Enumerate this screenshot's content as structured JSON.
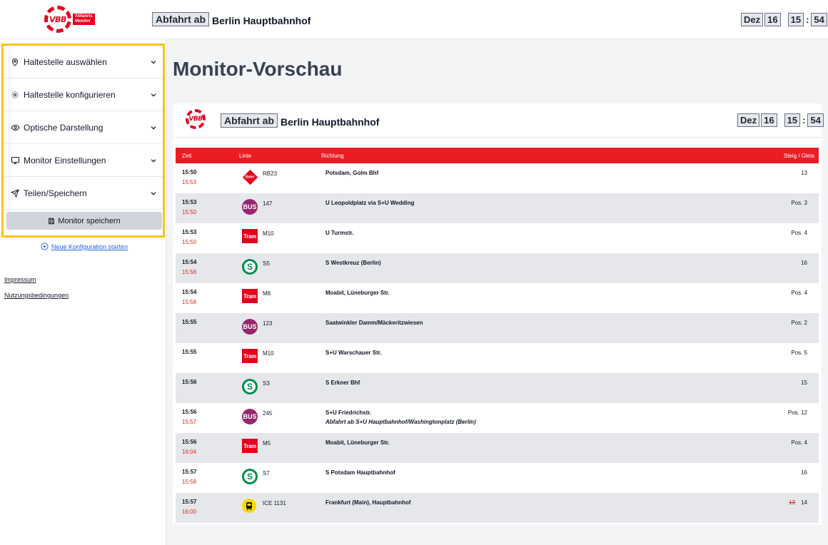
{
  "header": {
    "logo_text": "VBB",
    "logo_tag_line1": "Abfahrts",
    "logo_tag_line2": "Monitor",
    "mode_label": "Abfahrt ab",
    "station": "Berlin Hauptbahnhof",
    "month": "Dez",
    "day": "16",
    "hour": "15",
    "minute": "54",
    "time_sep": ":"
  },
  "sidebar": {
    "items": [
      {
        "label": "Haltestelle auswählen",
        "icon": "map-pin-icon"
      },
      {
        "label": "Haltestelle konfigurieren",
        "icon": "gear-icon"
      },
      {
        "label": "Optische Darstellung",
        "icon": "eye-icon"
      },
      {
        "label": "Monitor Einstellungen",
        "icon": "monitor-icon"
      },
      {
        "label": "Teilen/Speichern",
        "icon": "send-icon"
      }
    ],
    "save_button": "Monitor speichern",
    "new_config": "Neue Konfiguration starten",
    "impressum": "Impressum",
    "terms": "Nutzungsbedingungen"
  },
  "main": {
    "title": "Monitor-Vorschau"
  },
  "monitor": {
    "logo_text": "VBB",
    "mode_label": "Abfahrt ab",
    "station": "Berlin Hauptbahnhof",
    "month": "Dez",
    "day": "16",
    "hour": "15",
    "minute": "54",
    "time_sep": ":",
    "columns": {
      "time": "Zeit",
      "line": "Linie",
      "direction": "Richtung",
      "platform": "Steig / Gleis"
    },
    "rows": [
      {
        "plan": "15:50",
        "real": "15:53",
        "type": "bahn",
        "icon_text": "Bahn",
        "line": "RB23",
        "direction": "Potsdam, Golm Bhf",
        "note": "",
        "old_platform": "",
        "platform": "13"
      },
      {
        "plan": "15:53",
        "real": "15:50",
        "type": "bus",
        "icon_text": "BUS",
        "line": "147",
        "direction": "U Leopoldplatz via S+U Wedding",
        "note": "",
        "old_platform": "",
        "platform": "Pos. 3"
      },
      {
        "plan": "15:53",
        "real": "15:50",
        "type": "tram",
        "icon_text": "Tram",
        "line": "M10",
        "direction": "U Turmstr.",
        "note": "",
        "old_platform": "",
        "platform": "Pos. 4"
      },
      {
        "plan": "15:54",
        "real": "15:56",
        "type": "sbahn",
        "icon_text": "S",
        "line": "S5",
        "direction": "S Westkreuz (Berlin)",
        "note": "",
        "old_platform": "",
        "platform": "16"
      },
      {
        "plan": "15:54",
        "real": "15:58",
        "type": "tram",
        "icon_text": "Tram",
        "line": "M8",
        "direction": "Moabit, Lüneburger Str.",
        "note": "",
        "old_platform": "",
        "platform": "Pos. 4"
      },
      {
        "plan": "15:55",
        "real": "",
        "type": "bus",
        "icon_text": "BUS",
        "line": "123",
        "direction": "Saatwinkler Damm/Mäckeritzwiesen",
        "note": "",
        "old_platform": "",
        "platform": "Pos. 2"
      },
      {
        "plan": "15:55",
        "real": "",
        "type": "tram",
        "icon_text": "Tram",
        "line": "M10",
        "direction": "S+U Warschauer Str.",
        "note": "",
        "old_platform": "",
        "platform": "Pos. 5"
      },
      {
        "plan": "15:56",
        "real": "",
        "type": "sbahn",
        "icon_text": "S",
        "line": "S3",
        "direction": "S Erkner Bhf",
        "note": "",
        "old_platform": "",
        "platform": "15"
      },
      {
        "plan": "15:56",
        "real": "15:57",
        "type": "bus",
        "icon_text": "BUS",
        "line": "245",
        "direction": "S+U Friedrichstr.",
        "note": "Abfahrt ab S+U Hauptbahnhof/Washingtonplatz (Berlin)",
        "old_platform": "",
        "platform": "Pos. 12"
      },
      {
        "plan": "15:56",
        "real": "16:04",
        "type": "tram",
        "icon_text": "Tram",
        "line": "M5",
        "direction": "Moabit, Lüneburger Str.",
        "note": "",
        "old_platform": "",
        "platform": "Pos. 4"
      },
      {
        "plan": "15:57",
        "real": "15:58",
        "type": "sbahn",
        "icon_text": "S",
        "line": "S7",
        "direction": "S Potsdam Hauptbahnhof",
        "note": "",
        "old_platform": "",
        "platform": "16"
      },
      {
        "plan": "15:57",
        "real": "16:00",
        "type": "ice",
        "icon_text": "",
        "line": "ICE 1131",
        "direction": "Frankfurt (Main), Hauptbahnhof",
        "note": "",
        "old_platform": "13",
        "platform": "14"
      }
    ]
  },
  "colors": {
    "accent_red": "#ec1c24",
    "highlight_yellow": "#fac31a",
    "bus_purple": "#95276e",
    "sbahn_green": "#008d4f"
  }
}
